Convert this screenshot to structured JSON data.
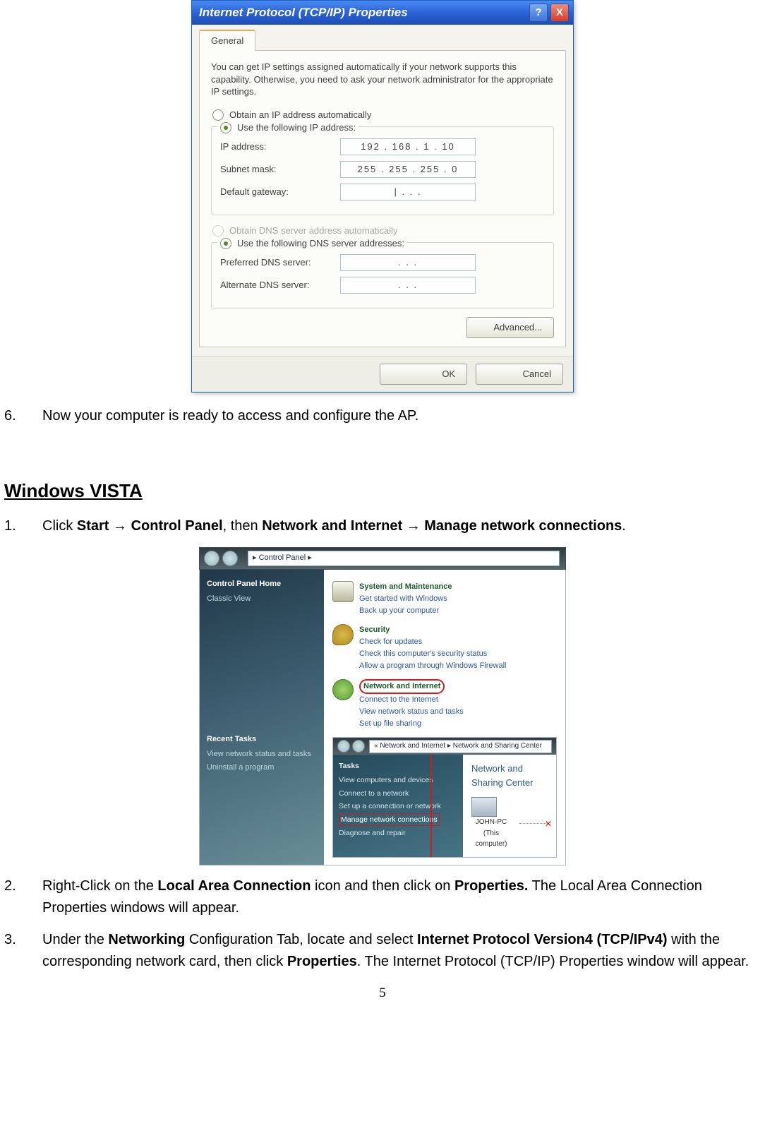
{
  "xp": {
    "title": "Internet Protocol (TCP/IP) Properties",
    "help_glyph": "?",
    "close_glyph": "X",
    "tab": "General",
    "intro": "You can get IP settings assigned automatically if your network supports this capability. Otherwise, you need to ask your network administrator for the appropriate IP settings.",
    "radio_auto_ip": "Obtain an IP address automatically",
    "radio_use_ip": "Use the following IP address:",
    "ip_label": "IP address:",
    "ip_value": "192 . 168 .   1   .  10",
    "subnet_label": "Subnet mask:",
    "subnet_value": "255 . 255 . 255 .   0",
    "gateway_label": "Default gateway:",
    "gateway_value": "|       .           .           .",
    "radio_auto_dns": "Obtain DNS server address automatically",
    "radio_use_dns": "Use the following DNS server addresses:",
    "pref_dns_label": "Preferred DNS server:",
    "pref_dns_value": ".           .           .",
    "alt_dns_label": "Alternate DNS server:",
    "alt_dns_value": ".           .           .",
    "advanced_btn": "Advanced...",
    "ok_btn": "OK",
    "cancel_btn": "Cancel"
  },
  "steps_top": {
    "n6": "6.",
    "t6": "Now your computer is ready to access and configure the AP."
  },
  "heading": "Windows VISTA",
  "vista_steps": {
    "n1": "1.",
    "t1_a": "Click ",
    "t1_b": "Start ",
    "t1_c": " Control Panel",
    "t1_d": ", then ",
    "t1_e": "Network and Internet ",
    "t1_f": " Manage network connections",
    "t1_g": ".",
    "arrow": "→",
    "n2": "2.",
    "t2_a": "Right-Click on the ",
    "t2_b": "Local Area Connection",
    "t2_c": " icon and then click on ",
    "t2_d": "Properties.",
    "t2_e": " The Local Area Connection Properties windows will appear.",
    "n3": "3.",
    "t3_a": "Under the ",
    "t3_b": "Networking",
    "t3_c": " Configuration Tab, locate and select ",
    "t3_d": "Internet Protocol Version4 (TCP/IPv4)",
    "t3_e": " with the corresponding network card, then click ",
    "t3_f": "Properties",
    "t3_g": ". The Internet Protocol (TCP/IP) Properties window will appear."
  },
  "vista": {
    "addr1": "▸  Control Panel  ▸",
    "side_head": "Control Panel Home",
    "side_classic": "Classic View",
    "side_recent": "Recent Tasks",
    "side_recent_1": "View network status and tasks",
    "side_recent_2": "Uninstall a program",
    "cat_sys_t": "System and Maintenance",
    "cat_sys_1": "Get started with Windows",
    "cat_sys_2": "Back up your computer",
    "cat_sec_t": "Security",
    "cat_sec_1": "Check for updates",
    "cat_sec_2": "Check this computer's security status",
    "cat_sec_3": "Allow a program through Windows Firewall",
    "cat_net_t": "Network and Internet",
    "cat_net_1": "Connect to the Internet",
    "cat_net_2": "View network status and tasks",
    "cat_net_3": "Set up file sharing",
    "addr2": "«  Network and Internet  ▸  Network and Sharing Center",
    "tasks_h": "Tasks",
    "tasks_1": "View computers and devices",
    "tasks_2": "Connect to a network",
    "tasks_3": "Set up a connection or network",
    "tasks_4": "Manage network connections",
    "tasks_5": "Diagnose and repair",
    "center_h": "Network and Sharing Center",
    "pc_name": "JOHN-PC",
    "pc_sub": "(This computer)"
  },
  "page_number": "5"
}
